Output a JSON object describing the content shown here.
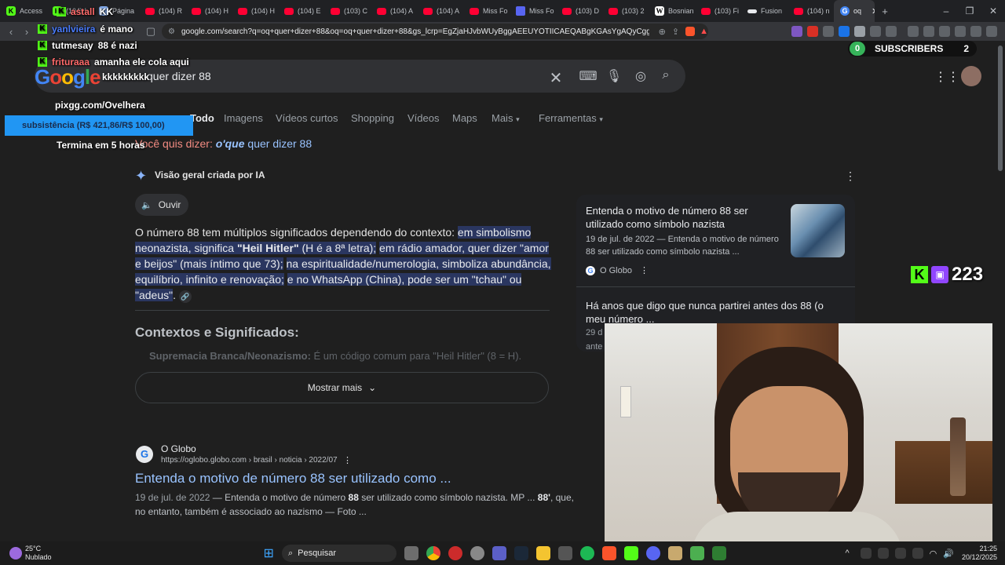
{
  "browser": {
    "tabs": [
      {
        "label": "Access",
        "icon": "kick-icon"
      },
      {
        "label": "(104) I",
        "icon": "youtube-icon"
      },
      {
        "label": "Página",
        "icon": "page-icon"
      },
      {
        "label": "(104) R",
        "icon": "youtube-icon"
      },
      {
        "label": "(104) H",
        "icon": "youtube-icon"
      },
      {
        "label": "(104) H",
        "icon": "youtube-icon"
      },
      {
        "label": "(104) E",
        "icon": "youtube-icon"
      },
      {
        "label": "(103) C",
        "icon": "youtube-icon"
      },
      {
        "label": "(104) A",
        "icon": "youtube-icon"
      },
      {
        "label": "(104) A",
        "icon": "youtube-icon"
      },
      {
        "label": "Miss Fo",
        "icon": "app-icon"
      },
      {
        "label": "Miss Fo",
        "icon": "google-icon"
      },
      {
        "label": "(103) D",
        "icon": "youtube-icon"
      },
      {
        "label": "(103) 2",
        "icon": "youtube-icon"
      },
      {
        "label": "Bosnian",
        "icon": "wikipedia-icon"
      },
      {
        "label": "(103) Fi",
        "icon": "youtube-icon"
      },
      {
        "label": "Fusion",
        "icon": "app-icon"
      },
      {
        "label": "(104) n",
        "icon": "youtube-icon"
      },
      {
        "label": "oq",
        "icon": "google-icon",
        "active": true
      }
    ],
    "url": "google.com/search?q=oq+quer+dizer+88&oq=oq+quer+dizer+88&gs_lcrp=EgZjaHJvbWUyBggAEEUYOTIICAEQABgKGAsYgAQyCggCEAAYCh..."
  },
  "chat": [
    {
      "user": "astall",
      "message": "KK",
      "user_color": "#ff6a6a"
    },
    {
      "user": "yanlvieira",
      "message": "é mano",
      "user_color": "#4a7dff"
    },
    {
      "user": "tutmesay",
      "message": "88 é nazi",
      "user_color": "#e8e8e8"
    },
    {
      "user": "frituraaa",
      "message": "amanha ele cola aqui",
      "user_color": "#ff6a6a"
    },
    {
      "user": "",
      "message": "kkkkkkkkk",
      "user_color": "#e8e8e8"
    }
  ],
  "stream": {
    "promo_url": "pixgg.com/Ovelhera",
    "goal": "subsistência (R$ 421,86/R$ 100,00)",
    "goal_timer": "Termina em 5 horas",
    "subs_left": "0",
    "subs_label": "SUBSCRIBERS",
    "subs_right": "2",
    "viewer_count": "223"
  },
  "search": {
    "logo": "Google",
    "query": "quer dizer 88",
    "tabs": [
      "Todo",
      "Imagens",
      "Vídeos curtos",
      "Shopping",
      "Vídeos",
      "Maps",
      "Mais",
      "Ferramentas"
    ],
    "did_you_mean_prefix": "Você quis dizer:",
    "did_you_mean_bold": "o'que",
    "did_you_mean_rest": "quer dizer 88"
  },
  "ai": {
    "header": "Visão geral criada por IA",
    "listen": "Ouvir",
    "p1": "O número 88 tem múltiplos significados dependendo do contexto: ",
    "h1": "em simbolismo neonazista, significa ",
    "h1b": "\"Heil Hitler\"",
    "h1c": " (H é a 8ª letra);",
    "h2": "em rádio amador, quer dizer \"amor e beijos\" (mais íntimo que 73);",
    "h3": "na espiritualidade/numerologia, simboliza abundância, equilíbrio, infinito e renovação;",
    "h4": "e no WhatsApp (China), pode ser um \"tchau\" ou \"adeus\"",
    "end": ".",
    "section": "Contextos e Significados:",
    "bullet_bold": "Supremacia Branca/Neonazismo:",
    "bullet_text": " É um código comum para \"Heil Hitler\" (8 = H).",
    "more": "Mostrar mais"
  },
  "side": {
    "card1_title": "Entenda o motivo de número 88 ser utilizado como símbolo nazista",
    "card1_snippet": "19 de jul. de 2022 — Entenda o motivo de número 88 ser utilizado como símbolo nazista ...",
    "card1_source": "O Globo",
    "card2_title": "Há anos que digo que nunca partirei antes dos 88 (o meu número ...",
    "card2_date": "29 d",
    "card2_more": "ante"
  },
  "result": {
    "source": "O Globo",
    "url": "https://oglobo.globo.com › brasil › noticia › 2022/07",
    "title": "Entenda o motivo de número 88 ser utilizado como ...",
    "date": "19 de jul. de 2022",
    "snippet_a": " — Entenda o motivo de número ",
    "snippet_b": "88",
    "snippet_c": " ser utilizado como símbolo nazista. MP ... ",
    "snippet_d": "88'",
    "snippet_e": ", que,",
    "snippet_2": "no entanto, também é associado ao nazismo — Foto ..."
  },
  "taskbar": {
    "temp": "25°C",
    "weather": "Nublado",
    "search": "Pesquisar",
    "time": "21:25",
    "date": "20/12/2025"
  },
  "colors": {
    "accent": "#53fc18",
    "link": "#99c3ff",
    "highlight": "#2a3660",
    "twitch": "#9146ff",
    "goal": "#2196f3"
  }
}
